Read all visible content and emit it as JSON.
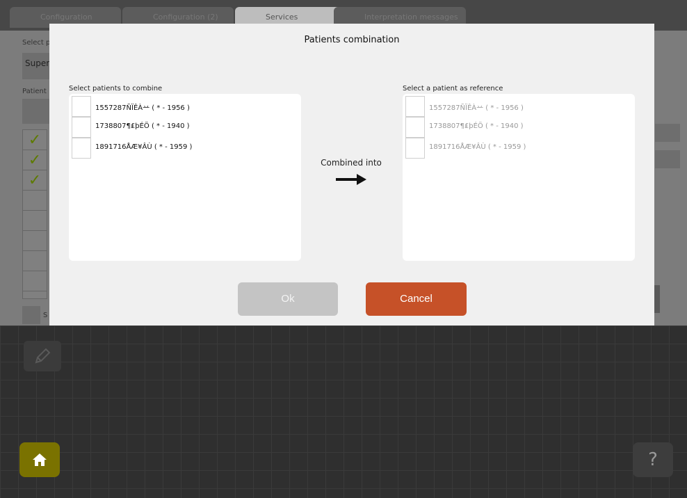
{
  "tabs": [
    {
      "label": "Configuration"
    },
    {
      "label": "Configuration (2)"
    },
    {
      "label": "Services"
    },
    {
      "label": "Interpretation messages"
    }
  ],
  "background": {
    "select_label": "Select p",
    "select_value": "Super",
    "patient_label": "Patient",
    "checks": [
      "✓",
      "✓",
      "✓",
      "",
      "",
      "",
      "",
      ""
    ],
    "bottom_checkbox_label": "S",
    "help_label": "?"
  },
  "modal": {
    "title": "Patients combination",
    "left_label": "Select patients to combine",
    "right_label": "Select a patient as reference",
    "combined_label": "Combined into",
    "patients_left": [
      {
        "text": "1557287ÑÏÊÀ䒑 ( * - 1956 )"
      },
      {
        "text": "1738807¶₤þÉÖ ( * - 1940 )"
      },
      {
        "text": "1891716ÅÆ¥ÂÙ ( * - 1959 )"
      }
    ],
    "patients_right": [
      {
        "text": "1557287ÑÏÊÀ䒑 ( * - 1956 )"
      },
      {
        "text": "1738807¶₤þÉÖ ( * - 1940 )"
      },
      {
        "text": "1891716ÅÆ¥ÂÙ ( * - 1959 )"
      }
    ],
    "ok_label": "Ok",
    "cancel_label": "Cancel"
  },
  "colors": {
    "cancel": "#c65128",
    "ok_disabled": "#c4c4c4",
    "home": "#7a7200"
  }
}
